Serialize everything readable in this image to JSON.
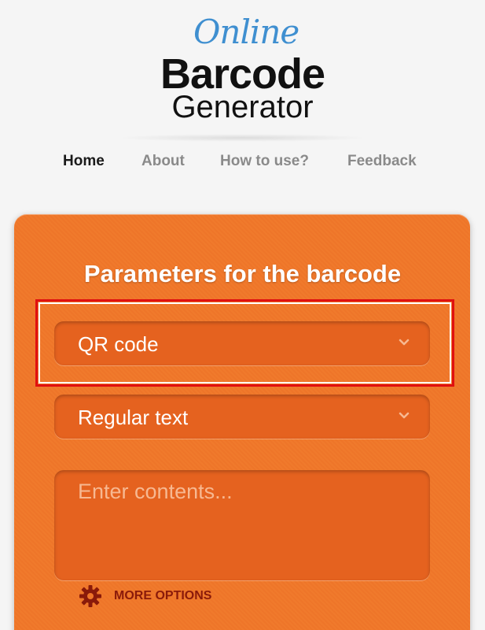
{
  "logo": {
    "line1": "Online",
    "line2": "Barcode",
    "line3": "Generator"
  },
  "nav": {
    "items": [
      {
        "label": "Home",
        "active": true
      },
      {
        "label": "About",
        "active": false
      },
      {
        "label": "How to use?",
        "active": false
      },
      {
        "label": "Feedback",
        "active": false
      }
    ]
  },
  "panel": {
    "title": "Parameters for the barcode",
    "barcode_type": "QR code",
    "content_type": "Regular text",
    "contents_placeholder": "Enter contents...",
    "contents_value": "",
    "more_options_label": "MORE OPTIONS"
  },
  "colors": {
    "panel_orange": "#f07a2c",
    "field_orange": "#e5621f",
    "highlight_red": "#e01010",
    "logo_blue": "#3f8fd0"
  },
  "icons": [
    "chevron-down-icon",
    "gear-icon"
  ]
}
